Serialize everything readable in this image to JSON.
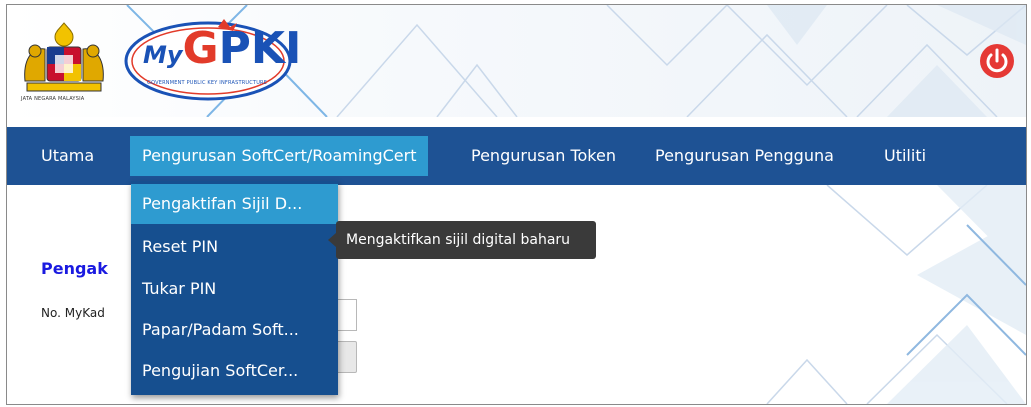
{
  "header": {
    "coat_of_arms_caption": "JATA NEGARA MALAYSIA",
    "logo": {
      "my": "My",
      "g": "G",
      "pki": "PKI",
      "subtitle": "GOVERNMENT PUBLIC KEY INFRASTRUCTURE"
    },
    "power_icon": "power-icon",
    "accent_color": "#e53935"
  },
  "nav": {
    "items": [
      {
        "label": "Utama"
      },
      {
        "label": "Pengurusan SoftCert/RoamingCert"
      },
      {
        "label": "Pengurusan Token"
      },
      {
        "label": "Pengurusan Pengguna"
      },
      {
        "label": "Utiliti"
      }
    ],
    "active_index": 1,
    "bar_color": "#1e5294",
    "active_color": "#2e9bd0"
  },
  "dropdown": {
    "items": [
      {
        "label": "Pengaktifan Sijil D..."
      },
      {
        "label": "Reset PIN"
      },
      {
        "label": "Tukar PIN"
      },
      {
        "label": "Papar/Padam Soft..."
      },
      {
        "label": "Pengujian SoftCer..."
      }
    ],
    "hover_index": 0
  },
  "tooltip": {
    "text": "Mengaktifkan sijil digital baharu"
  },
  "main": {
    "section_title": "Pengak",
    "field_label": "No. MyKad"
  }
}
